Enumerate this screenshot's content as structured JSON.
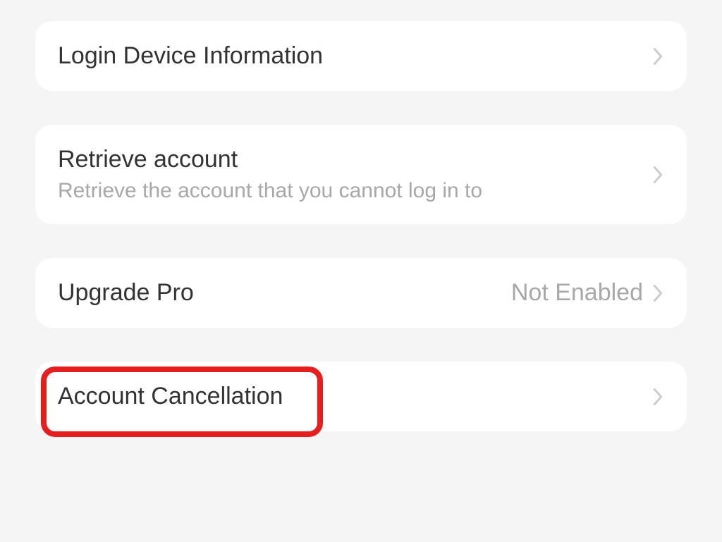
{
  "items": {
    "loginDevice": {
      "title": "Login Device Information"
    },
    "retrieveAccount": {
      "title": "Retrieve account",
      "subtitle": "Retrieve the account that you cannot log in to"
    },
    "upgradePro": {
      "title": "Upgrade Pro",
      "value": "Not Enabled"
    },
    "accountCancellation": {
      "title": "Account Cancellation"
    }
  }
}
